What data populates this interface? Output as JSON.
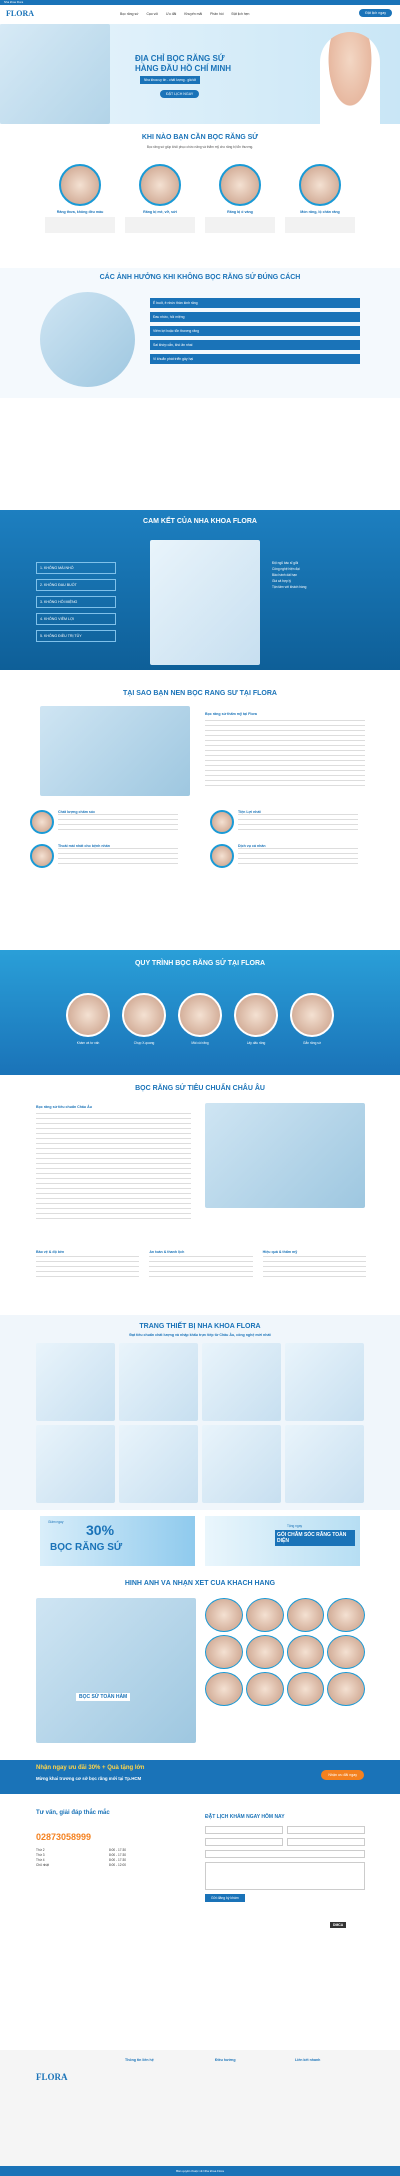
{
  "topbar": {
    "text": "Nha khoa Flora"
  },
  "nav": {
    "brand": "FLORA",
    "items": [
      "Bọc răng sứ",
      "Cạo vôi",
      "Ưu đãi",
      "Khuyến mãi",
      "Phản hồi",
      "Đặt lịch hẹn"
    ],
    "cta": "Đặt lịch ngay"
  },
  "hero": {
    "title1": "ĐỊA CHỈ BỌC RĂNG SỨ",
    "title2": "HÀNG ĐẦU HỒ CHÍ MINH",
    "sub": "Nha khoa uy tín - chất lượng - giá tốt",
    "cta": "ĐẶT LỊCH NGAY"
  },
  "who": {
    "title": "KHI NÀO BẠN CẦN BỌC RĂNG SỨ",
    "p1": "Bọc răng sứ giúp khôi phục chức năng và thẩm mỹ cho răng bị tổn thương.",
    "cards": [
      {
        "t": "Răng thưa, không đều màu"
      },
      {
        "t": "Răng bị mẻ, vỡ, sứt"
      },
      {
        "t": "Răng bị ố vàng"
      },
      {
        "t": "Mòn răng, lộ chân răng"
      }
    ]
  },
  "effects": {
    "title": "CÁC ẢNH HƯỞNG KHI KHÔNG BỌC RĂNG SỨ ĐÚNG CÁCH",
    "items": [
      "Ê buốt, ê nhức thần kinh răng",
      "Đau nhức, hôi miệng",
      "Viêm lợi hoặc tổn thương răng",
      "Sai khớp cắn, khó ăn nhai",
      "Vi khuẩn phát triển gây hại"
    ]
  },
  "commit": {
    "title": "CAM KẾT CỦA NHA KHOA FLORA",
    "items": [
      "1. KHÔNG MÀI NHỎ",
      "2. KHÔNG ĐAU BUỐT",
      "3. KHÔNG HÔI MIỆNG",
      "4. KHÔNG VIÊM LỢI",
      "5. KHÔNG ĐIỀU TRỊ TỦY"
    ],
    "checks": [
      "Đội ngũ bác sĩ giỏi",
      "Công nghệ hiện đại",
      "Bảo hành dài hạn",
      "Giá cả hợp lý",
      "Tận tâm với khách hàng"
    ]
  },
  "why": {
    "title": "TẠI SAO BẠN NÊN BỌC RĂNG SỨ TẠI FLORA",
    "head": "Bọc răng sứ thẩm mỹ tại Flora",
    "f": [
      {
        "t": "Chất lượng chăm sóc"
      },
      {
        "t": "Tiện Lợi nhất"
      },
      {
        "t": "Thoải mái nhất cho bệnh nhân"
      },
      {
        "t": "Dịch vụ cá nhân"
      }
    ]
  },
  "process": {
    "title": "QUY TRÌNH BỌC RĂNG SỨ TẠI FLORA",
    "steps": [
      "Khám và tư vấn",
      "Chụp X-quang",
      "Mài cùi răng",
      "Lấy dấu răng",
      "Gắn răng sứ"
    ]
  },
  "euro": {
    "title": "BỌC RĂNG SỨ TIÊU CHUẨN CHÂU ÂU",
    "head": "Bọc răng sứ tiêu chuẩn Châu Âu",
    "b": [
      {
        "t": "Bảo vệ & độ bền"
      },
      {
        "t": "An toàn & thanh lịch"
      },
      {
        "t": "Hiệu quả & thẩm mỹ"
      }
    ]
  },
  "equip": {
    "title": "TRANG THIẾT BỊ NHA KHOA FLORA",
    "sub": "Đạt tiêu chuẩn chất lượng và nhập khẩu trực tiếp từ Châu Âu, công nghệ mới nhất"
  },
  "promo": {
    "l1": "Giảm ngay",
    "pct": "30%",
    "l2": "BỌC RĂNG SỨ",
    "r1": "Tặng ngay",
    "r2": "GÓI CHĂM SÓC RĂNG TOÀN DIỆN"
  },
  "gallery": {
    "title": "HÌNH ẢNH VÀ NHẬN XÉT CỦA KHÁCH HÀNG",
    "badge": "BỌC SỨ TOÀN HÀM"
  },
  "band": {
    "t1": "Nhận ngay ưu đãi 30% + Quà tặng lớn",
    "t2": "Mừng khai trương cơ sở bọc răng mới tại Tp.HCM",
    "btn": "Nhận ưu đãi ngay"
  },
  "contact": {
    "title": "Tư vấn, giải đáp thắc mắc",
    "phone": "02873058999",
    "hours": [
      [
        "Thứ 2",
        "8:00 - 17:30"
      ],
      [
        "Thứ 3",
        "8:00 - 17:30"
      ],
      [
        "Thứ 4",
        "8:00 - 17:30"
      ],
      [
        "Chủ nhật",
        "8:00 - 12:00"
      ]
    ],
    "ftitle": "ĐẶT LỊCH KHÁM NGAY HÔM NAY",
    "submit": "Gửi đăng ký khám",
    "dmca": "DMCA"
  },
  "footer": {
    "brand": "FLORA",
    "cols": [
      "Thông tin liên hệ",
      "Điều hướng",
      "Liên kết nhanh"
    ],
    "copy": "Bản quyền thuộc về Nha khoa Flora"
  }
}
